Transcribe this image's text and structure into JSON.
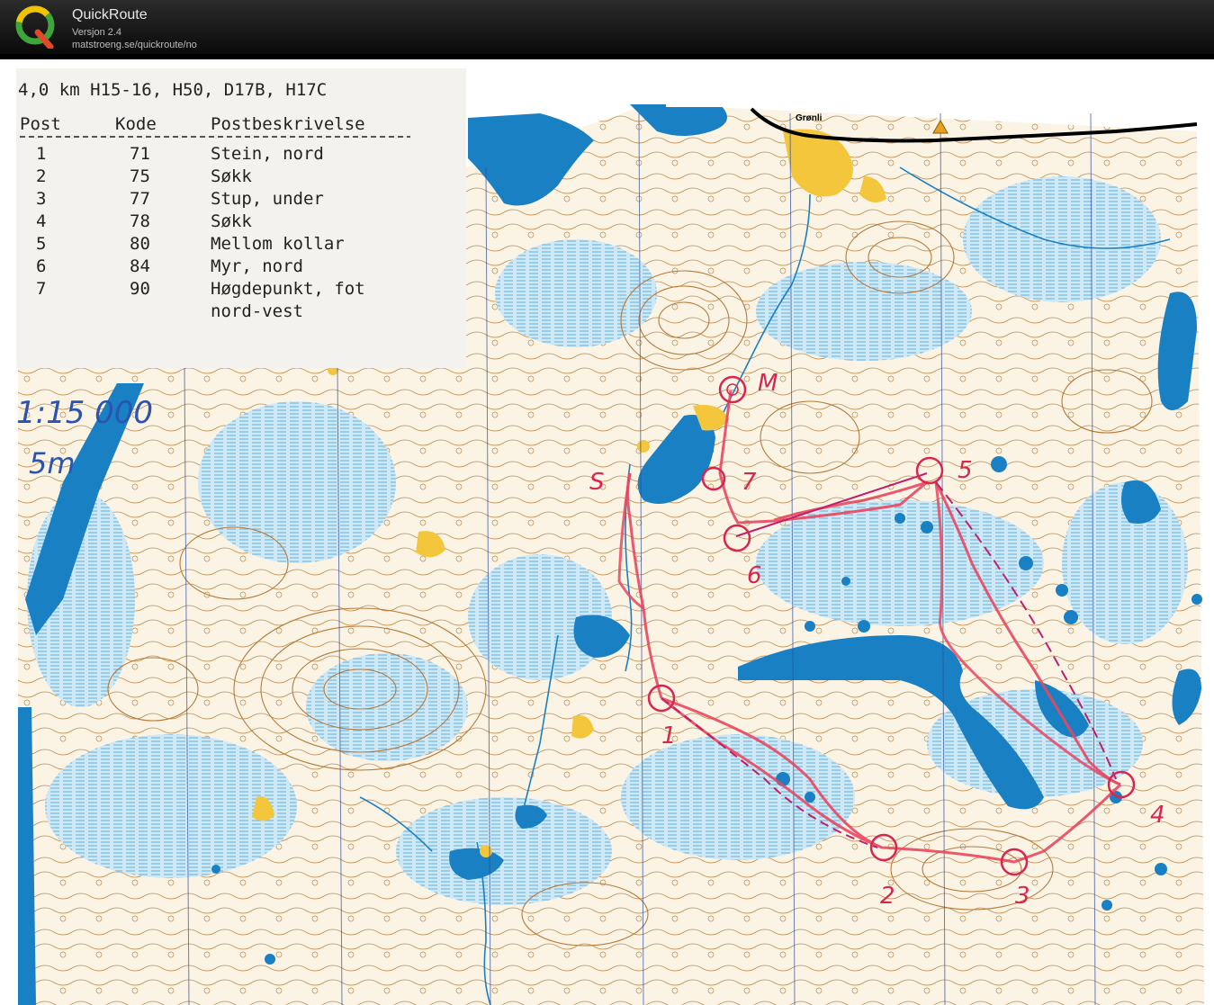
{
  "app": {
    "title": "QuickRoute",
    "version": "Versjon 2.4",
    "url": "matstroeng.se/quickroute/no",
    "logo_letter": "Q"
  },
  "course_card": {
    "header": "4,0 km  H15-16, H50, D17B, H17C",
    "columns": [
      "Post",
      "Kode",
      "Postbeskrivelse"
    ],
    "rows": [
      {
        "post": "1",
        "kode": "71",
        "desc": "Stein, nord"
      },
      {
        "post": "2",
        "kode": "75",
        "desc": "Søkk"
      },
      {
        "post": "3",
        "kode": "77",
        "desc": "Stup, under"
      },
      {
        "post": "4",
        "kode": "78",
        "desc": "Søkk"
      },
      {
        "post": "5",
        "kode": "80",
        "desc": "Mellom kollar"
      },
      {
        "post": "6",
        "kode": "84",
        "desc": "Myr, nord"
      },
      {
        "post": "7",
        "kode": "90",
        "desc": "Høgdepunkt, fot"
      },
      {
        "post": "",
        "kode": "",
        "desc": "nord-vest"
      }
    ]
  },
  "handwritten": {
    "scale": "1:15 000",
    "equidistance": "5m"
  },
  "map_labels": {
    "place": "Grønli"
  },
  "controls": [
    {
      "id": "M",
      "label": "M"
    },
    {
      "id": "1",
      "label": "1"
    },
    {
      "id": "2",
      "label": "2"
    },
    {
      "id": "3",
      "label": "3"
    },
    {
      "id": "4",
      "label": "4"
    },
    {
      "id": "5",
      "label": "5"
    },
    {
      "id": "6",
      "label": "6"
    },
    {
      "id": "7",
      "label": "7"
    },
    {
      "id": "S",
      "label": "S"
    }
  ],
  "colors": {
    "water": "#1a80c4",
    "marsh": "#9fd3ef",
    "contour": "#b77a38",
    "open_land": "#f3c63c",
    "route": "#e8475f",
    "course": "#c0206a",
    "paper": "#ffffff",
    "terrain": "#f7ecd8"
  }
}
